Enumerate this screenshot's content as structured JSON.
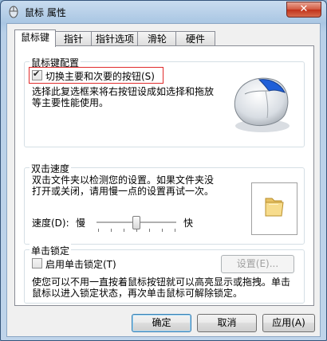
{
  "window": {
    "title": "鼠标 属性",
    "close_label": "✕",
    "icon": "mouse-app-icon"
  },
  "tabs": [
    {
      "label": "鼠标键",
      "active": true
    },
    {
      "label": "指针",
      "active": false
    },
    {
      "label": "指针选项",
      "active": false
    },
    {
      "label": "滑轮",
      "active": false
    },
    {
      "label": "硬件",
      "active": false
    }
  ],
  "button_config": {
    "legend": "鼠标键配置",
    "switch_label": "切换主要和次要的按钮(S)",
    "switch_checked": true,
    "description_line1": "选择此复选框来将右按钮设成如选择和拖放",
    "description_line2": "等主要性能使用。",
    "accent_color": "#1f5fd8"
  },
  "double_click": {
    "legend": "双击速度",
    "description_line1": "双击文件夹以检测您的设置。如果文件夹没",
    "description_line2": "打开或关闭，请用慢一点的设置再试一次。",
    "speed_label": "速度(D):",
    "slow_label": "慢",
    "fast_label": "快",
    "speed_level": 0.5,
    "folder_icon": "folder-icon"
  },
  "click_lock": {
    "legend": "单击锁定",
    "enable_label": "启用单击锁定(T)",
    "enable_checked": false,
    "settings_label": "设置(E)...",
    "description_line1": "使您可以不用一直按着鼠标按钮就可以高亮显示或拖拽。单击",
    "description_line2": "鼠标以进入锁定状态，再次单击鼠标可解除锁定。"
  },
  "footer": {
    "ok_label": "确定",
    "cancel_label": "取消",
    "apply_label": "应用(A)"
  }
}
